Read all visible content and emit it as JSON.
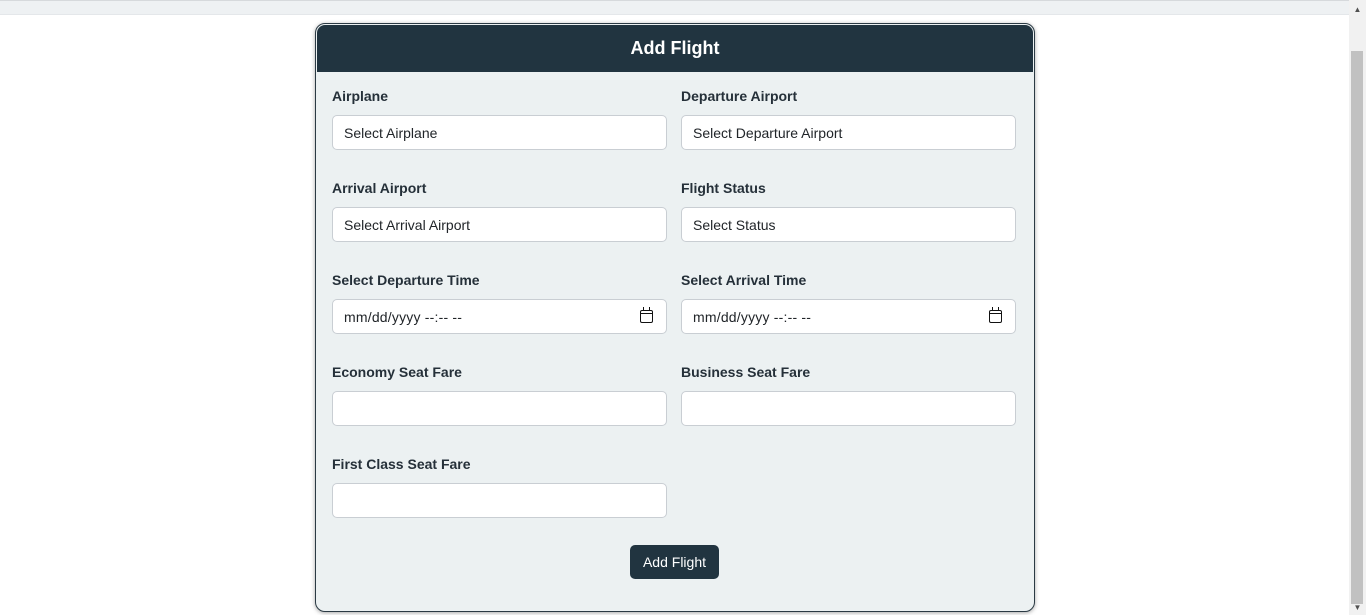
{
  "form": {
    "title": "Add Flight",
    "fields": {
      "airplane": {
        "label": "Airplane",
        "value": "Select Airplane"
      },
      "departure_airport": {
        "label": "Departure Airport",
        "value": "Select Departure Airport"
      },
      "arrival_airport": {
        "label": "Arrival Airport",
        "value": "Select Arrival Airport"
      },
      "flight_status": {
        "label": "Flight Status",
        "value": "Select Status"
      },
      "departure_time": {
        "label": "Select Departure Time",
        "value": "mm/dd/yyyy --:-- --"
      },
      "arrival_time": {
        "label": "Select Arrival Time",
        "value": "mm/dd/yyyy --:-- --"
      },
      "economy_fare": {
        "label": "Economy Seat Fare",
        "value": ""
      },
      "business_fare": {
        "label": "Business Seat Fare",
        "value": ""
      },
      "first_class_fare": {
        "label": "First Class Seat Fare",
        "value": ""
      }
    },
    "submit_label": "Add Flight"
  },
  "icons": {
    "calendar": "calendar-icon",
    "scroll_up": "scroll-up-arrow",
    "scroll_down": "scroll-down-arrow"
  },
  "colors": {
    "header_bg": "#213440",
    "card_bg": "#ecf1f2",
    "button_bg": "#213440"
  }
}
